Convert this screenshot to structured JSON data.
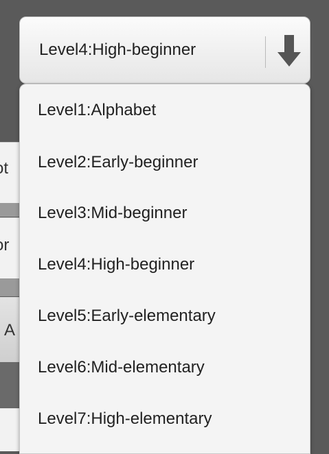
{
  "select": {
    "value": "Level4:High-beginner",
    "arrow_icon": "arrow-down-icon"
  },
  "dropdown": {
    "options": [
      "Level1:Alphabet",
      "Level2:Early-beginner",
      "Level3:Mid-beginner",
      "Level4:High-beginner",
      "Level5:Early-elementary",
      "Level6:Mid-elementary",
      "Level7:High-elementary"
    ]
  },
  "background": {
    "fragments": [
      "ot",
      "or",
      "A"
    ]
  },
  "colors": {
    "backdrop": "#5a5a5a",
    "panel": "#f4f4f4",
    "text": "#222222",
    "arrow": "#555555"
  }
}
